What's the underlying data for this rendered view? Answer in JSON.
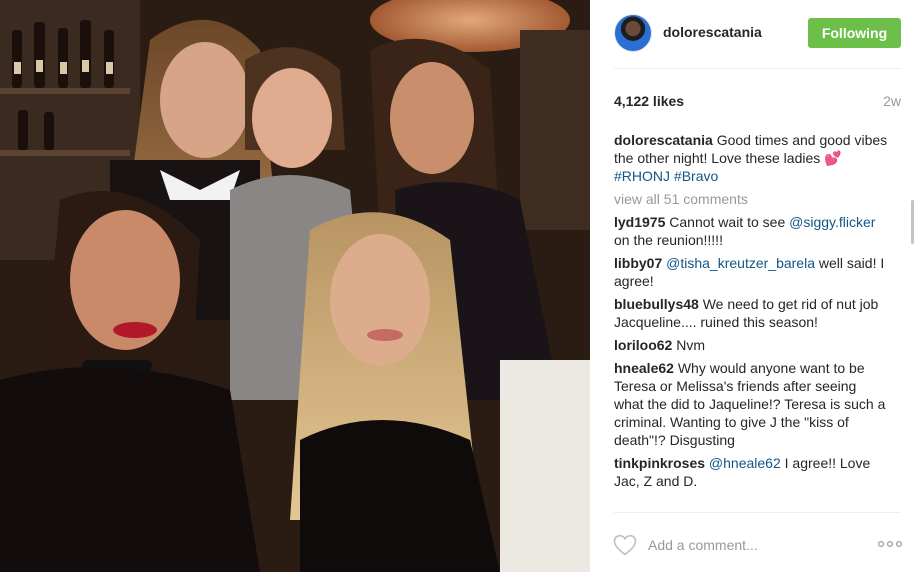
{
  "post": {
    "username": "dolorescatania",
    "follow_label": "Following",
    "likes": "4,122 likes",
    "age": "2w",
    "caption": {
      "user": "dolorescatania",
      "text": "Good times and good vibes the other night! Love these ladies",
      "emoji": "💕",
      "tags": [
        "#RHONJ",
        "#Bravo"
      ]
    },
    "view_all": "view all 51 comments",
    "comments": [
      {
        "user": "lyd1975",
        "pre": "Cannot wait to see ",
        "mention": "@siggy.flicker",
        "post": " on the reunion!!!!!"
      },
      {
        "user": "libby07",
        "pre": "",
        "mention": "@tisha_kreutzer_barela",
        "post": " well said! I agree!"
      },
      {
        "user": "bluebullys48",
        "pre": "We need to get rid of nut job Jacqueline.... ruined this season!",
        "mention": "",
        "post": ""
      },
      {
        "user": "loriloo62",
        "pre": "Nvm",
        "mention": "",
        "post": ""
      },
      {
        "user": "hneale62",
        "pre": "Why would anyone want to be Teresa or Melissa's friends after seeing what the did to Jaqueline!? Teresa is such a criminal. Wanting to give J the \"kiss of death\"!? Disgusting",
        "mention": "",
        "post": ""
      },
      {
        "user": "tinkpinkroses",
        "pre": "",
        "mention": "@hneale62",
        "post": " I agree!! Love Jac, Z and D."
      }
    ],
    "add_comment_placeholder": "Add a comment...",
    "icons": {
      "like": "heart-icon",
      "more": "more-options-icon"
    },
    "colors": {
      "follow": "#6cc04a",
      "link": "#125688",
      "muted": "#999999"
    }
  }
}
